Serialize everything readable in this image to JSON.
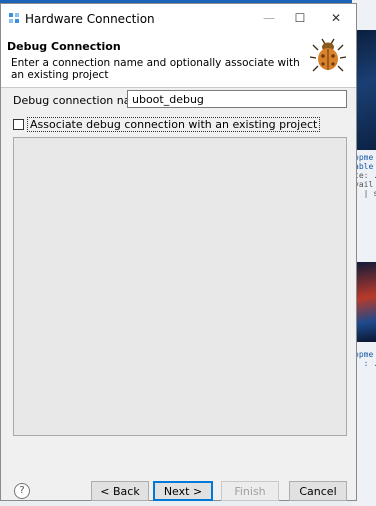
{
  "window": {
    "title": "Hardware Connection",
    "minimize_glyph": "—",
    "maximize_glyph": "☐",
    "close_glyph": "✕"
  },
  "header": {
    "title": "Debug Connection",
    "description": "Enter a connection name and optionally associate with an existing project",
    "icon": "bug-icon"
  },
  "form": {
    "name_label": "Debug connection name:",
    "name_value": "uboot_debug",
    "associate_label": "Associate debug connection with an existing project",
    "associate_checked": false
  },
  "footer": {
    "help_glyph": "?",
    "back_label": "< Back",
    "next_label": "Next >",
    "finish_label": "Finish",
    "cancel_label": "Cancel"
  },
  "background": {
    "text_lines_1": [
      "opme",
      "able",
      "te: .",
      "vail",
      "",
      "] | s"
    ],
    "text_lines_2": [
      "opme",
      ". : ."
    ]
  },
  "colors": {
    "accent": "#0078d7",
    "bug_body": "#d9822b"
  }
}
